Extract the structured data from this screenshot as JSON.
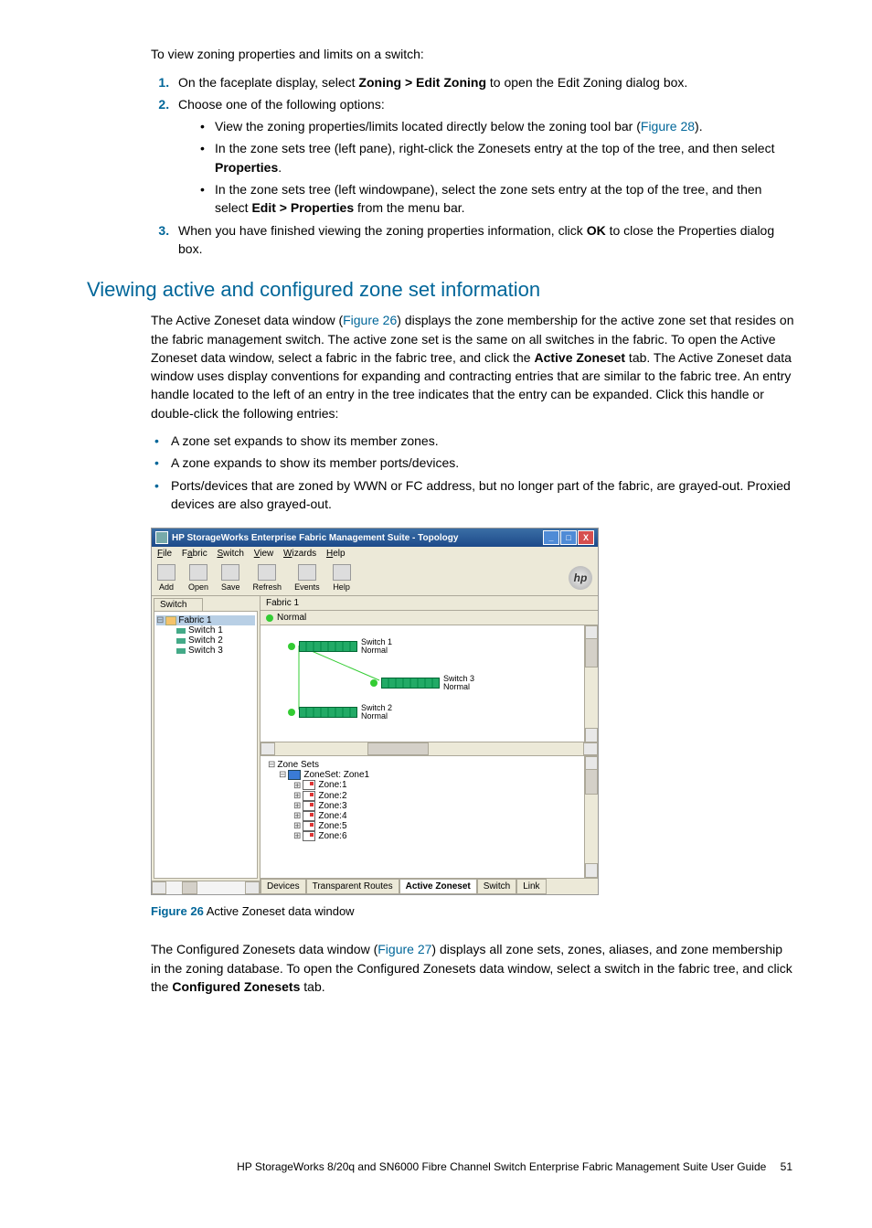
{
  "intro": "To view zoning properties and limits on a switch:",
  "steps": {
    "s1_a": "On the faceplate display, select ",
    "s1_b": "Zoning > Edit Zoning",
    "s1_c": " to open the Edit Zoning dialog box.",
    "s2": "Choose one of the following options:",
    "s2_b1_a": "View the zoning properties/limits located directly below the zoning tool bar (",
    "s2_b1_link": "Figure 28",
    "s2_b1_b": ").",
    "s2_b2_a": "In the zone sets tree (left pane), right-click the Zonesets entry at the top of the tree, and then select ",
    "s2_b2_b": "Properties",
    "s2_b2_c": ".",
    "s2_b3_a": "In the zone sets tree (left windowpane), select the zone sets entry at the top of the tree, and then select ",
    "s2_b3_b": "Edit > Properties",
    "s2_b3_c": " from the menu bar.",
    "s3_a": "When you have finished viewing the zoning properties information, click ",
    "s3_b": "OK",
    "s3_c": " to close the Properties dialog box."
  },
  "section_title": "Viewing active and configured zone set information",
  "p1": {
    "a": "The Active Zoneset data window (",
    "link1": "Figure 26",
    "b": ") displays the zone membership for the active zone set that resides on the fabric management switch. The active zone set is the same on all switches in the fabric. To open the Active Zoneset data window, select a fabric in the fabric tree, and click the ",
    "bold1": "Active Zoneset",
    "c": " tab. The Active Zoneset data window uses display conventions for expanding and contracting entries that are similar to the fabric tree. An entry handle located to the left of an entry in the tree indicates that the entry can be expanded. Click this handle or double-click the following entries:"
  },
  "bullets": {
    "b1": "A zone set expands to show its member zones.",
    "b2": "A zone expands to show its member ports/devices.",
    "b3": "Ports/devices that are zoned by WWN or FC address, but no longer part of the fabric, are grayed-out. Proxied devices are also grayed-out."
  },
  "fig": {
    "title": "HP StorageWorks Enterprise Fabric Management Suite - Topology",
    "menus": {
      "file": "File",
      "fabric": "Fabric",
      "switch": "Switch",
      "view": "View",
      "wizards": "Wizards",
      "help": "Help"
    },
    "tools": {
      "add": "Add",
      "open": "Open",
      "save": "Save",
      "refresh": "Refresh",
      "events": "Events",
      "help": "Help"
    },
    "logo": "hp",
    "swtab": "Switch",
    "tree": {
      "fabric": "Fabric 1",
      "s1": "Switch 1",
      "s2": "Switch 2",
      "s3": "Switch 3"
    },
    "rheader": "Fabric 1",
    "rstatus": "Normal",
    "nodes": {
      "n1": {
        "name": "Switch 1",
        "status": "Normal"
      },
      "n2": {
        "name": "Switch 3",
        "status": "Normal"
      },
      "n3": {
        "name": "Switch 2",
        "status": "Normal"
      }
    },
    "zroot": "Zone Sets",
    "zset": "ZoneSet: Zone1",
    "zones": {
      "z1": "Zone:1",
      "z2": "Zone:2",
      "z3": "Zone:3",
      "z4": "Zone:4",
      "z5": "Zone:5",
      "z6": "Zone:6"
    },
    "tabs": {
      "t1": "Devices",
      "t2": "Transparent Routes",
      "t3": "Active Zoneset",
      "t4": "Switch",
      "t5": "Link"
    }
  },
  "figcap_label": "Figure 26",
  "figcap_text": " Active Zoneset data window",
  "p2": {
    "a": "The Configured Zonesets data window (",
    "link1": "Figure 27",
    "b": ") displays all zone sets, zones, aliases, and zone membership in the zoning database. To open the Configured Zonesets data window, select a switch in the fabric tree, and click the ",
    "bold1": "Configured Zonesets",
    "c": " tab."
  },
  "footer_text": "HP StorageWorks 8/20q and SN6000 Fibre Channel Switch Enterprise Fabric Management Suite User Guide",
  "footer_page": "51"
}
